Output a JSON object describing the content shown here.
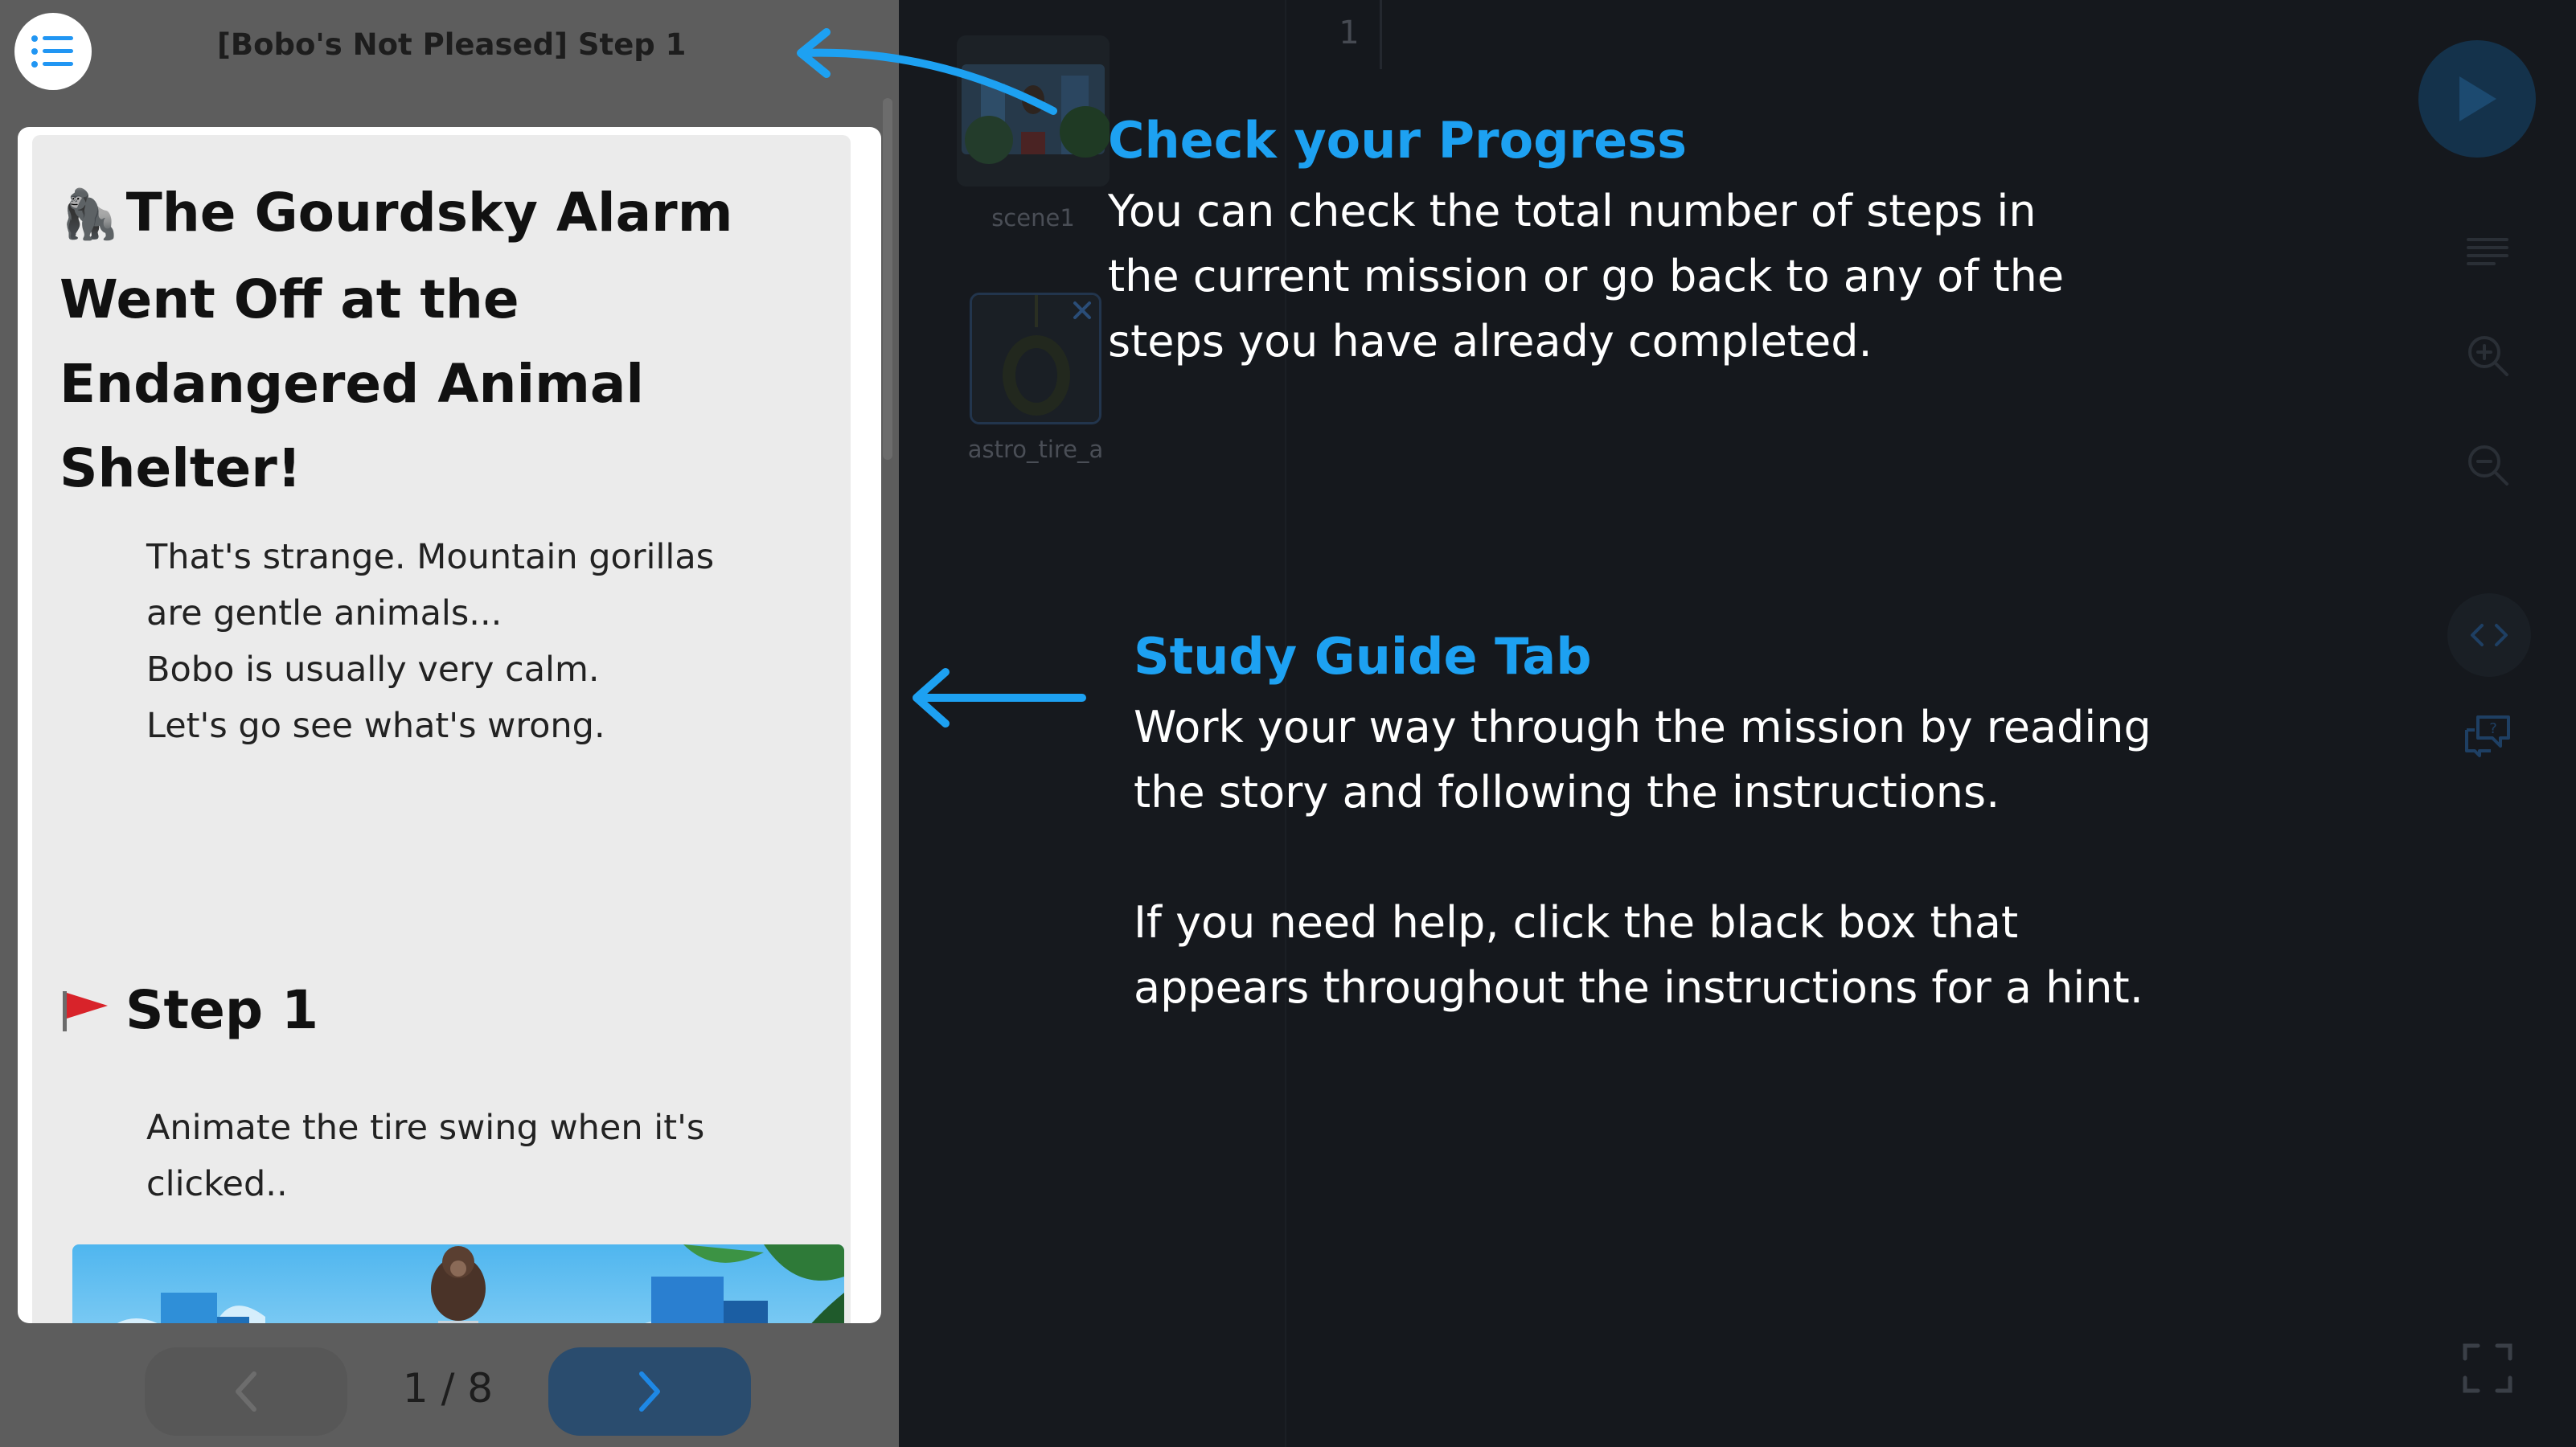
{
  "guide": {
    "title": "[Bobo's Not Pleased] Step 1",
    "heading_emoji": "🦍",
    "heading": "The Gourdsky Alarm Went Off at the Endangered Animal Shelter!",
    "story_lines": [
      "That's strange. Mountain gorillas",
      "are gentle animals...",
      "Bobo is usually very calm.",
      "Let's go see what's wrong."
    ],
    "step_title": "Step 1",
    "step_lines": [
      "Animate the tire swing when it's",
      "clicked.."
    ],
    "page_indicator": "1 / 8"
  },
  "editor": {
    "line_number": "1",
    "sprites": [
      {
        "label": "scene1"
      },
      {
        "label": "astro_tire_a"
      }
    ]
  },
  "callouts": {
    "progress": {
      "title": "Check your Progress",
      "lines": [
        "You can check the total number of steps in",
        "the current mission or go back to any of the",
        "steps you have already completed."
      ]
    },
    "study_guide": {
      "title": "Study Guide Tab",
      "lines": [
        "Work your way through the mission by reading",
        "the story and following the instructions."
      ],
      "help_lines": [
        "If you need help, click the black box that",
        "appears throughout the instructions for a hint."
      ]
    }
  },
  "icons": {
    "menu": "list-icon",
    "prev": "chevron-left-icon",
    "next": "chevron-right-icon",
    "run": "play-icon",
    "step_flag": "red-flag-icon"
  },
  "colors": {
    "accent": "#1da1f2",
    "panel_gray": "#5d5d5d",
    "editor_bg": "#15181d"
  }
}
